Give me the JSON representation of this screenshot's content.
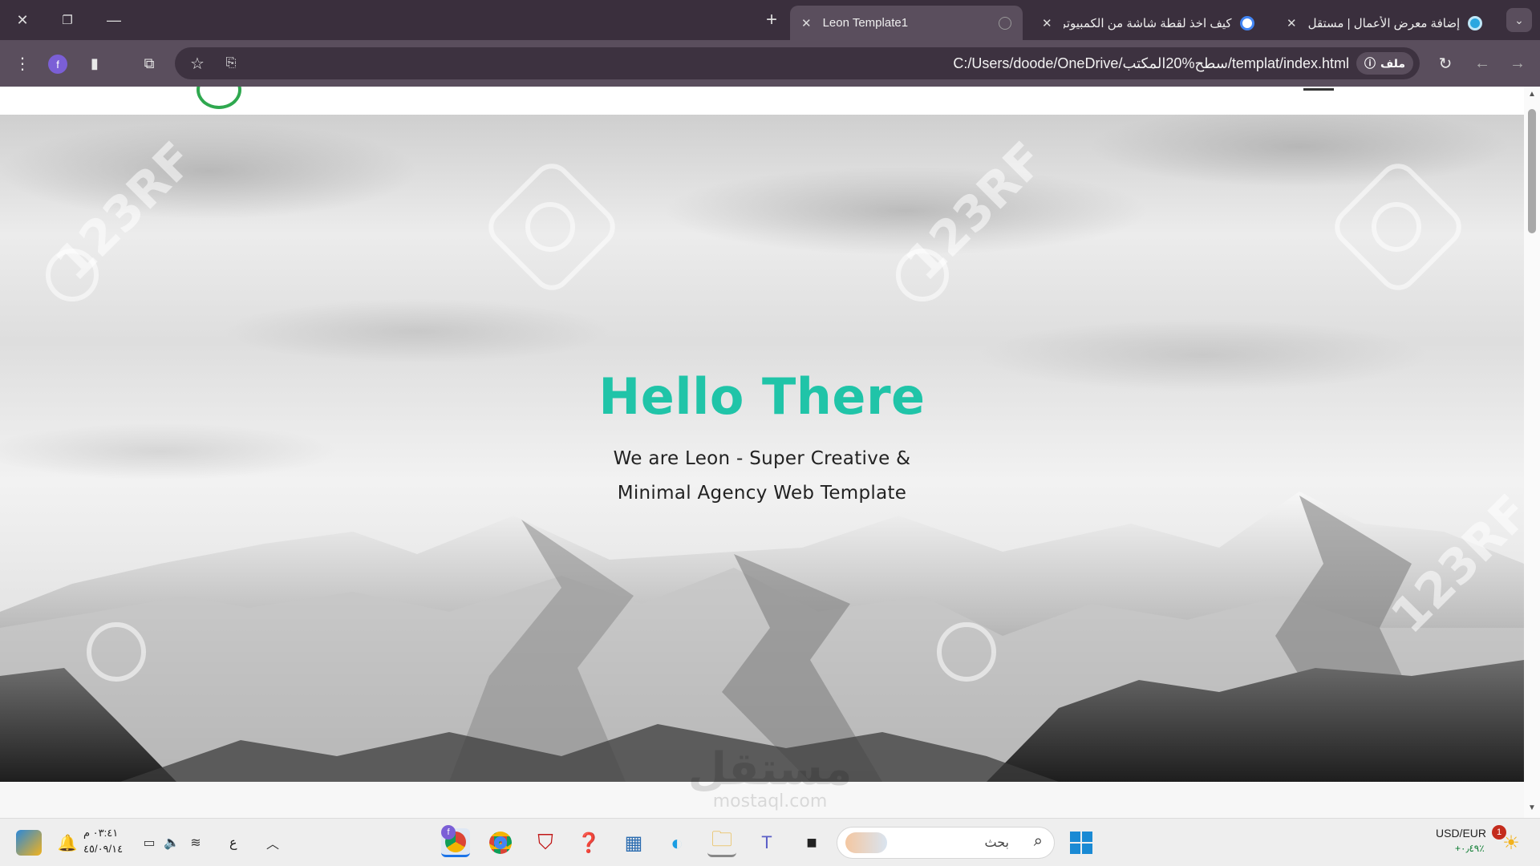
{
  "browser": {
    "tabs": [
      {
        "title": "Leon Template1",
        "active": true
      },
      {
        "title": "كيف اخذ لقطة شاشة من الكمبيوتر",
        "active": false
      },
      {
        "title": "إضافة معرض الأعمال | مستقل",
        "active": false
      }
    ],
    "new_tab_symbol": "+",
    "site_chip_label": "ملف",
    "url": "C:/Users/doode/OneDrive/سطح%20المكتب/templat/index.html",
    "profile_initial": "f"
  },
  "page": {
    "hero": {
      "title": "Hello There",
      "subtitle_line1": "We are Leon - Super Creative &",
      "subtitle_line2": "Minimal Agency Web Template"
    },
    "watermark_text": "123RF",
    "footer_watermark": "مستقل",
    "footer_watermark_sub": "mostaql.com"
  },
  "taskbar": {
    "time": "٠٣:٤١ م",
    "date": "٤٥/٠٩/١٤",
    "language": "ع",
    "search_placeholder": "بحث",
    "currency_pair": "USD/EUR",
    "currency_change": "+٠٫٤٩٪",
    "notification_count": "1",
    "chrome_profile_badge": "f"
  },
  "colors": {
    "accent": "#20c4a8",
    "tabbar": "#3a2f3d",
    "toolbar": "#5a4e5d"
  }
}
